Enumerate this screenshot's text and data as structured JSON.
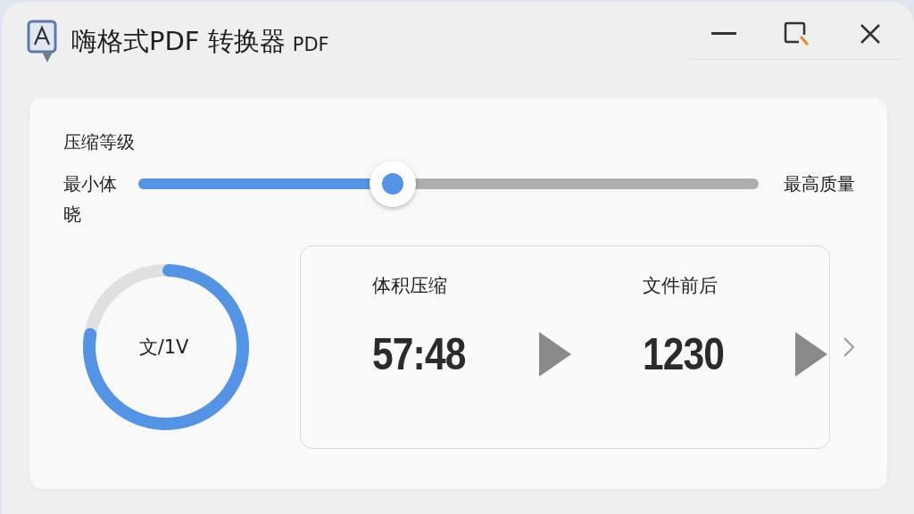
{
  "window": {
    "title": "嗨格式PDF 转换器",
    "title_suffix": "PDF"
  },
  "compression": {
    "label": "压缩等级",
    "min_label": "最小体晓",
    "max_label": "最高质量",
    "level": 0.41
  },
  "ring": {
    "label": "文/1V"
  },
  "stats": [
    {
      "heading": "体积压缩",
      "value": "57:48"
    },
    {
      "heading": "文件前后",
      "value": "1230"
    }
  ]
}
